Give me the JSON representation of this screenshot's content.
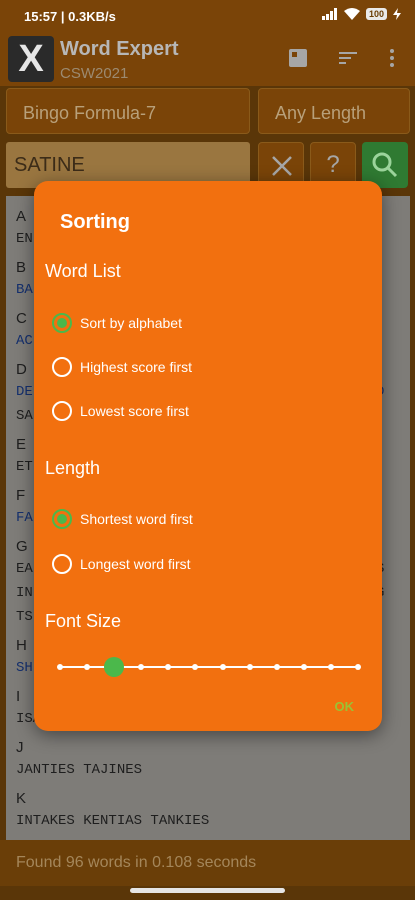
{
  "status_bar": {
    "time": "15:57",
    "net_speed": "0.3KB/s",
    "battery": "100"
  },
  "app_bar": {
    "logo_letter": "X",
    "title": "Word Expert",
    "subtitle": "CSW2021"
  },
  "filters": {
    "formula": "Bingo Formula-7",
    "length": "Any Length"
  },
  "search": {
    "value": "SATINE",
    "help_label": "?"
  },
  "results": {
    "lines": [
      {
        "text": "A",
        "kind": "letter"
      },
      {
        "text": "EN",
        "kind": "word"
      },
      {
        "text": "B",
        "kind": "letter"
      },
      {
        "text": "BA",
        "kind": "word",
        "highlight": true
      },
      {
        "text": "C",
        "kind": "letter"
      },
      {
        "text": "AC",
        "kind": "word",
        "highlight": true
      },
      {
        "text": "D",
        "kind": "letter"
      },
      {
        "text": "DE",
        "kind": "word",
        "highlight": true,
        "tail": "D"
      },
      {
        "text": "SA",
        "kind": "word"
      },
      {
        "text": "E",
        "kind": "letter"
      },
      {
        "text": "ET",
        "kind": "word"
      },
      {
        "text": "F",
        "kind": "letter"
      },
      {
        "text": "FA",
        "kind": "word",
        "highlight": true
      },
      {
        "text": "G",
        "kind": "letter"
      },
      {
        "text": "EA",
        "kind": "word",
        "tail": "S"
      },
      {
        "text": "IN",
        "kind": "word",
        "tail": "G"
      },
      {
        "text": "TS",
        "kind": "word"
      },
      {
        "text": "H",
        "kind": "letter"
      },
      {
        "text": "SH",
        "kind": "word",
        "highlight": true
      },
      {
        "text": "I",
        "kind": "letter"
      },
      {
        "text": "ISATINE",
        "kind": "word"
      },
      {
        "text": "J",
        "kind": "letter"
      },
      {
        "text": "JANTIES TAJINES",
        "kind": "word"
      },
      {
        "text": "K",
        "kind": "letter"
      },
      {
        "text": "INTAKES KENTIAS TANKIES",
        "kind": "word"
      }
    ],
    "summary": "Found 96 words in 0.108 seconds"
  },
  "dialog": {
    "title": "Sorting",
    "word_list": {
      "heading": "Word List",
      "options": [
        "Sort by alphabet",
        "Highest score first",
        "Lowest score first"
      ],
      "selected": "Sort by alphabet"
    },
    "length": {
      "heading": "Length",
      "options": [
        "Shortest word first",
        "Longest word first"
      ],
      "selected": "Shortest word first"
    },
    "font_size": {
      "heading": "Font Size",
      "steps": 12,
      "selected_step": 3
    },
    "ok_label": "OK"
  },
  "colors": {
    "dialog_bg": "#f2700f",
    "accent_green": "#4bb84b",
    "ok_green": "#9bc234"
  }
}
